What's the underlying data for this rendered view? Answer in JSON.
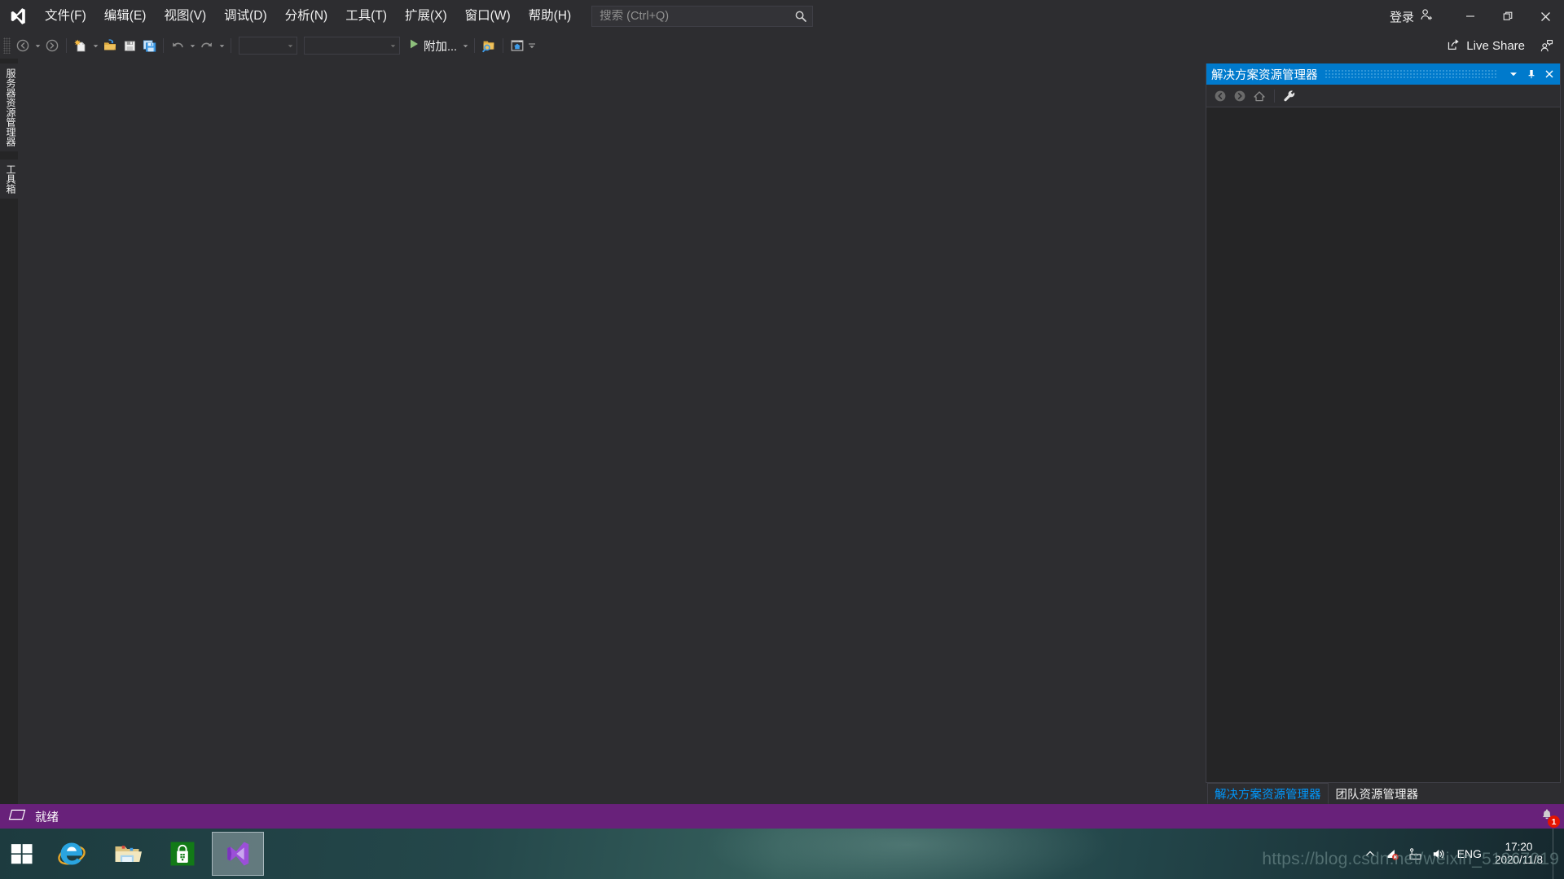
{
  "app": {
    "name": "Visual Studio",
    "theme_colors": {
      "window_bg": "#2d2d30",
      "panel_bg": "#252526",
      "accent_blue": "#007acc",
      "status_purple": "#68217a",
      "active_tab_text": "#0097fb",
      "badge_red": "#e51400"
    }
  },
  "menu": {
    "items": [
      {
        "label": "文件(F)"
      },
      {
        "label": "编辑(E)"
      },
      {
        "label": "视图(V)"
      },
      {
        "label": "调试(D)"
      },
      {
        "label": "分析(N)"
      },
      {
        "label": "工具(T)"
      },
      {
        "label": "扩展(X)"
      },
      {
        "label": "窗口(W)"
      },
      {
        "label": "帮助(H)"
      }
    ]
  },
  "search": {
    "placeholder": "搜索 (Ctrl+Q)",
    "value": "",
    "icon": "search-icon"
  },
  "titlebar": {
    "signin_label": "登录",
    "signin_icon": "person-add-icon",
    "minimize_icon": "minimize-icon",
    "restore_icon": "restore-icon",
    "close_icon": "close-icon"
  },
  "toolbar": {
    "nav_back_icon": "navigate-back-icon",
    "nav_forward_icon": "navigate-forward-icon",
    "new_file_icon": "new-file-icon",
    "open_file_icon": "open-folder-icon",
    "save_icon": "save-icon",
    "save_all_icon": "save-all-icon",
    "undo_icon": "undo-icon",
    "redo_icon": "redo-icon",
    "combo1_value": "",
    "combo2_value": "",
    "run_label": "附加...",
    "run_icon": "play-icon",
    "find_in_files_icon": "folder-search-icon",
    "window_layout_icon": "window-home-icon",
    "overflow_icon": "toolbar-overflow-icon",
    "live_share_label": "Live Share",
    "live_share_icon": "share-icon",
    "feedback_icon": "feedback-person-icon"
  },
  "left_dock": {
    "tabs": [
      {
        "label": "服务器资源管理器"
      },
      {
        "label": "工具箱"
      }
    ]
  },
  "solution_explorer": {
    "title": "解决方案资源管理器",
    "header_icons": {
      "dropdown": "chevron-down-icon",
      "pin": "pin-icon",
      "close": "close-icon"
    },
    "toolbar_icons": {
      "back": "back-arrow-icon",
      "forward": "forward-arrow-icon",
      "home": "home-icon",
      "properties": "wrench-icon"
    },
    "content_items": [],
    "tabs": [
      {
        "label": "解决方案资源管理器",
        "active": true
      },
      {
        "label": "团队资源管理器",
        "active": false
      }
    ]
  },
  "statusbar": {
    "status_icon": "ready-parallelogram-icon",
    "status_text": "就绪",
    "notification_icon": "bell-icon",
    "notification_count": "1"
  },
  "taskbar": {
    "start_icon": "windows-start-icon",
    "apps": [
      {
        "name": "internet-explorer",
        "active": false
      },
      {
        "name": "file-explorer",
        "active": false
      },
      {
        "name": "microsoft-store",
        "active": false
      },
      {
        "name": "visual-studio",
        "active": true
      }
    ],
    "tray": {
      "show_hidden_icon": "chevron-up-icon",
      "network_icon": "network-disconnected-icon",
      "input_icon": "input-indicator-icon",
      "volume_icon": "volume-icon",
      "language": "ENG",
      "time": "17:20",
      "date": "2020/11/8"
    }
  },
  "watermark": {
    "text": "https://blog.csdn.net/weixin_51967019"
  }
}
